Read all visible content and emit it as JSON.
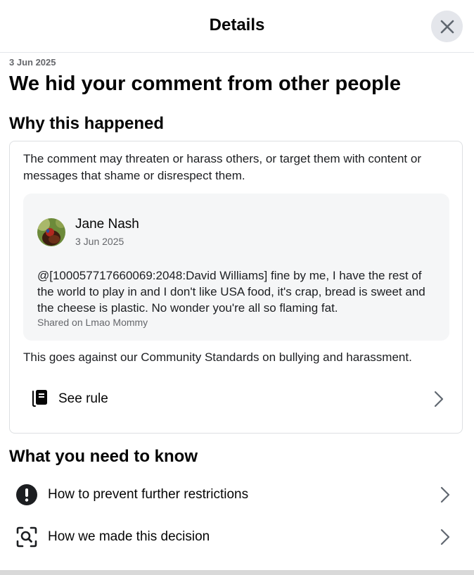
{
  "header": {
    "title": "Details",
    "close_icon": "close-icon"
  },
  "date": "3 Jun 2025",
  "headline": "We hid your comment from other people",
  "why": {
    "title": "Why this happened",
    "reason": "The comment may threaten or harass others, or target them with content or messages that shame or disrespect them.",
    "comment": {
      "author": "Jane Nash",
      "date": "3 Jun 2025",
      "text": "@[100057717660069:2048:David Williams] fine by me, I have the rest of the world to play in and I don't like USA food, it's crap, bread is sweet and the cheese is plastic. No wonder you're all so flaming fat.",
      "shared_on": "Shared on Lmao Mommy"
    },
    "standards": "This goes against our Community Standards on bullying and harassment.",
    "see_rule": {
      "label": "See rule",
      "icon": "rulebook-icon"
    }
  },
  "know": {
    "title": "What you need to know",
    "items": [
      {
        "label": "How to prevent further restrictions",
        "icon": "exclamation-icon"
      },
      {
        "label": "How we made this decision",
        "icon": "magnifier-icon"
      }
    ]
  },
  "colors": {
    "text": "#050505",
    "secondary": "#65676b",
    "card_bg": "#f5f6f7",
    "border": "#dddfe2"
  }
}
